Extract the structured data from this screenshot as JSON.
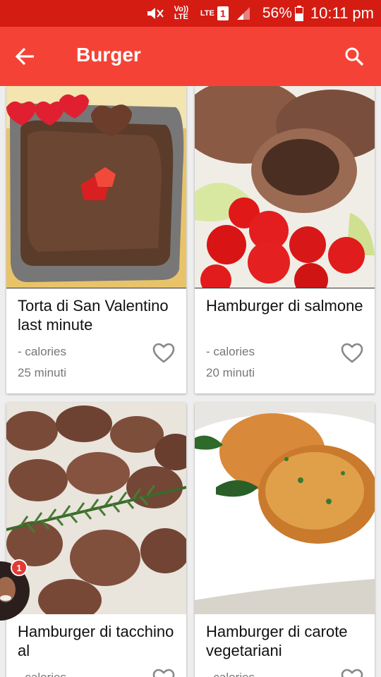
{
  "status_bar": {
    "volte_label": "Vo)) LTE",
    "lte_label": "LTE",
    "sim_label": "1",
    "battery": "56%",
    "time": "10:11 pm"
  },
  "app_bar": {
    "title": "Burger"
  },
  "recipes": [
    {
      "title": "Torta di San Valentino last minute",
      "calories": "- calories",
      "time": "25 minuti"
    },
    {
      "title": "Hamburger di salmone",
      "calories": "- calories",
      "time": "20 minuti"
    },
    {
      "title": "Hamburger di tacchino al",
      "calories": "- calories",
      "time": ""
    },
    {
      "title": "Hamburger di carote vegetariani",
      "calories": "- calories",
      "time": ""
    }
  ],
  "chat_head": {
    "badge_count": "1"
  },
  "colors": {
    "status_bar": "#d41c13",
    "app_bar": "#f44336",
    "background": "#eeeeee"
  }
}
